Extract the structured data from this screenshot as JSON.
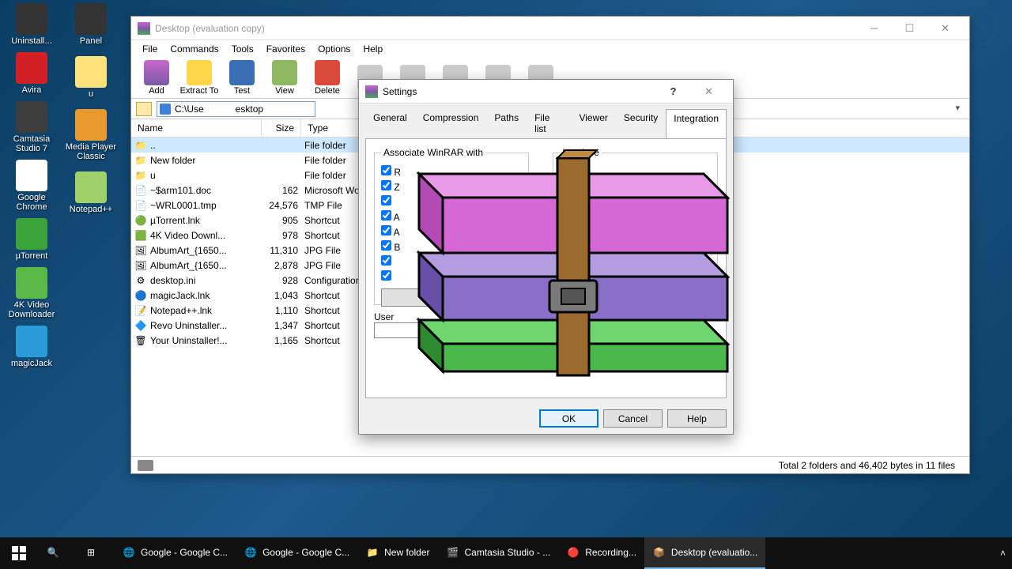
{
  "desktop": {
    "col1": [
      {
        "label": "Uninstall...",
        "bg": "#333"
      },
      {
        "label": "Avira",
        "bg": "#d32027"
      },
      {
        "label": "Camtasia Studio 7",
        "bg": "#3e3e3e"
      },
      {
        "label": "Google Chrome",
        "bg": "#fff"
      },
      {
        "label": "µTorrent",
        "bg": "#3aa33a"
      },
      {
        "label": "4K Video Downloader",
        "bg": "#5bb94a"
      },
      {
        "label": "magicJack",
        "bg": "#2b9bd8"
      }
    ],
    "col2": [
      {
        "label": "Panel",
        "bg": "#333"
      },
      {
        "label": "u",
        "bg": "#ffe27a"
      },
      {
        "label": "Media Player Classic",
        "bg": "#e99a2e"
      },
      {
        "label": "Notepad++",
        "bg": "#9fd06a"
      }
    ]
  },
  "winrar": {
    "title": "Desktop (evaluation copy)",
    "menus": [
      "File",
      "Commands",
      "Tools",
      "Favorites",
      "Options",
      "Help"
    ],
    "toolbar": [
      "Add",
      "Extract To",
      "Test",
      "View",
      "Delete"
    ],
    "address": "C:\\Use            esktop",
    "columns": [
      "Name",
      "Size",
      "Type"
    ],
    "files": [
      {
        "name": "..",
        "size": "",
        "type": "File folder",
        "icon": "📁",
        "sel": true
      },
      {
        "name": "New folder",
        "size": "",
        "type": "File folder",
        "icon": "📁"
      },
      {
        "name": "u",
        "size": "",
        "type": "File folder",
        "icon": "📁"
      },
      {
        "name": "~$arm101.doc",
        "size": "162",
        "type": "Microsoft Word",
        "icon": "📄"
      },
      {
        "name": "~WRL0001.tmp",
        "size": "24,576",
        "type": "TMP File",
        "icon": "📄"
      },
      {
        "name": "µTorrent.lnk",
        "size": "905",
        "type": "Shortcut",
        "icon": "🟢"
      },
      {
        "name": "4K Video Downl...",
        "size": "978",
        "type": "Shortcut",
        "icon": "🟩"
      },
      {
        "name": "AlbumArt_{1650...",
        "size": "11,310",
        "type": "JPG File",
        "icon": "🖼"
      },
      {
        "name": "AlbumArt_{1650...",
        "size": "2,878",
        "type": "JPG File",
        "icon": "🖼"
      },
      {
        "name": "desktop.ini",
        "size": "928",
        "type": "Configuration s",
        "icon": "⚙"
      },
      {
        "name": "magicJack.lnk",
        "size": "1,043",
        "type": "Shortcut",
        "icon": "🔵"
      },
      {
        "name": "Notepad++.lnk",
        "size": "1,110",
        "type": "Shortcut",
        "icon": "📝"
      },
      {
        "name": "Revo Uninstaller...",
        "size": "1,347",
        "type": "Shortcut",
        "icon": "🔷"
      },
      {
        "name": "Your Uninstaller!...",
        "size": "1,165",
        "type": "Shortcut",
        "icon": "🗑"
      }
    ],
    "status": "Total 2 folders and 46,402 bytes in 11 files"
  },
  "settings": {
    "title": "Settings",
    "tabs": [
      "General",
      "Compression",
      "Paths",
      "File list",
      "Viewer",
      "Security",
      "Integration"
    ],
    "active_tab": "Integration",
    "groupbox1": "Associate WinRAR with",
    "groupbox2": "Interface",
    "user_label": "User",
    "btn_ok": "OK",
    "btn_cancel": "Cancel",
    "btn_help": "Help"
  },
  "taskbar": {
    "items": [
      {
        "label": "Google - Google C...",
        "active": false,
        "icon": "chrome"
      },
      {
        "label": "Google - Google C...",
        "active": false,
        "icon": "chrome"
      },
      {
        "label": "New folder",
        "active": false,
        "icon": "folder"
      },
      {
        "label": "Camtasia Studio - ...",
        "active": false,
        "icon": "camtasia"
      },
      {
        "label": "Recording...",
        "active": false,
        "icon": "rec"
      },
      {
        "label": "Desktop (evaluatio...",
        "active": true,
        "icon": "winrar"
      }
    ]
  }
}
